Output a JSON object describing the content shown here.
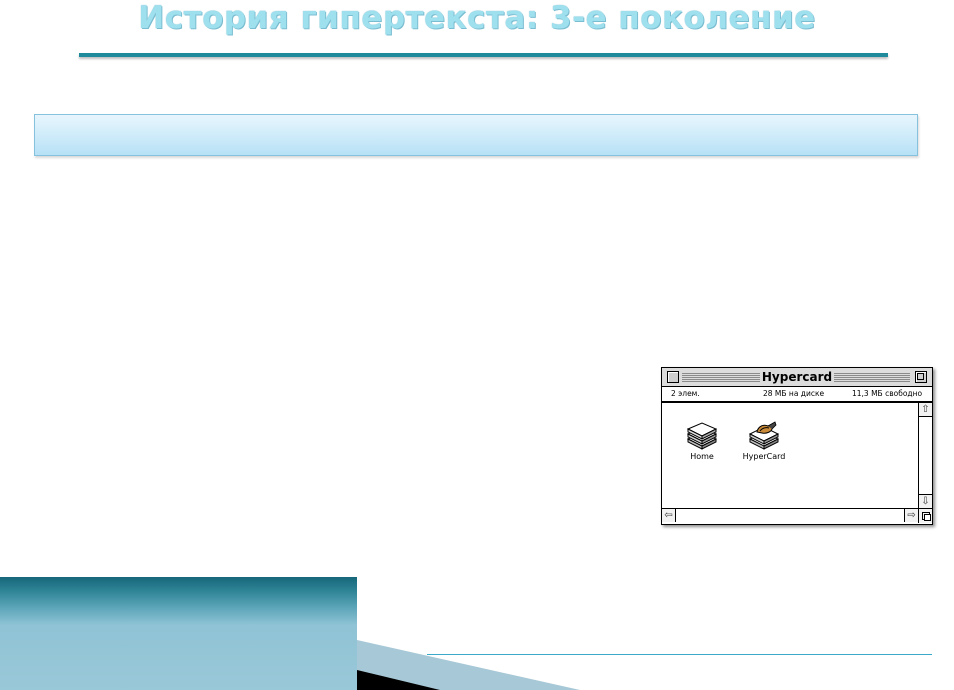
{
  "slide": {
    "title": "История гипертекста: 3-е поколение",
    "banner_text": ""
  },
  "window": {
    "title": "Hypercard",
    "items_count": "2 элем.",
    "disk_usage": "28 МБ на диске",
    "free_space": "11,3 МБ свободно",
    "files": [
      {
        "label": "Home",
        "icon": "stack-icon"
      },
      {
        "label": "HyperCard",
        "icon": "hypercard-app-icon"
      }
    ]
  },
  "colors": {
    "title": "#9fe0ef",
    "rule": "#1e8a9c",
    "banner": "#c7e8f8",
    "accent_block": "#16677a"
  }
}
